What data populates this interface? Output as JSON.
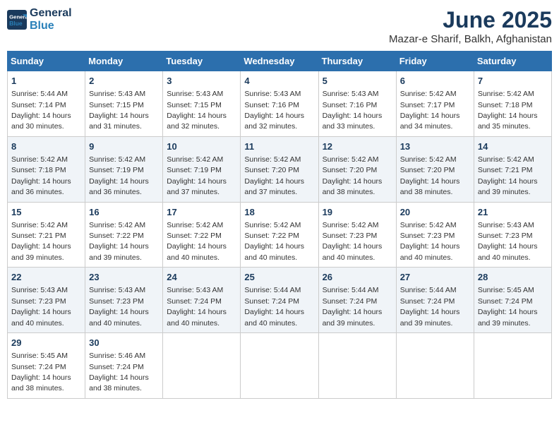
{
  "logo": {
    "line1": "General",
    "line2": "Blue"
  },
  "title": "June 2025",
  "location": "Mazar-e Sharif, Balkh, Afghanistan",
  "weekdays": [
    "Sunday",
    "Monday",
    "Tuesday",
    "Wednesday",
    "Thursday",
    "Friday",
    "Saturday"
  ],
  "rows": [
    [
      {
        "day": "1",
        "sunrise": "5:44 AM",
        "sunset": "7:14 PM",
        "daylight": "14 hours and 30 minutes."
      },
      {
        "day": "2",
        "sunrise": "5:43 AM",
        "sunset": "7:15 PM",
        "daylight": "14 hours and 31 minutes."
      },
      {
        "day": "3",
        "sunrise": "5:43 AM",
        "sunset": "7:15 PM",
        "daylight": "14 hours and 32 minutes."
      },
      {
        "day": "4",
        "sunrise": "5:43 AM",
        "sunset": "7:16 PM",
        "daylight": "14 hours and 32 minutes."
      },
      {
        "day": "5",
        "sunrise": "5:43 AM",
        "sunset": "7:16 PM",
        "daylight": "14 hours and 33 minutes."
      },
      {
        "day": "6",
        "sunrise": "5:42 AM",
        "sunset": "7:17 PM",
        "daylight": "14 hours and 34 minutes."
      },
      {
        "day": "7",
        "sunrise": "5:42 AM",
        "sunset": "7:18 PM",
        "daylight": "14 hours and 35 minutes."
      }
    ],
    [
      {
        "day": "8",
        "sunrise": "5:42 AM",
        "sunset": "7:18 PM",
        "daylight": "14 hours and 36 minutes."
      },
      {
        "day": "9",
        "sunrise": "5:42 AM",
        "sunset": "7:19 PM",
        "daylight": "14 hours and 36 minutes."
      },
      {
        "day": "10",
        "sunrise": "5:42 AM",
        "sunset": "7:19 PM",
        "daylight": "14 hours and 37 minutes."
      },
      {
        "day": "11",
        "sunrise": "5:42 AM",
        "sunset": "7:20 PM",
        "daylight": "14 hours and 37 minutes."
      },
      {
        "day": "12",
        "sunrise": "5:42 AM",
        "sunset": "7:20 PM",
        "daylight": "14 hours and 38 minutes."
      },
      {
        "day": "13",
        "sunrise": "5:42 AM",
        "sunset": "7:20 PM",
        "daylight": "14 hours and 38 minutes."
      },
      {
        "day": "14",
        "sunrise": "5:42 AM",
        "sunset": "7:21 PM",
        "daylight": "14 hours and 39 minutes."
      }
    ],
    [
      {
        "day": "15",
        "sunrise": "5:42 AM",
        "sunset": "7:21 PM",
        "daylight": "14 hours and 39 minutes."
      },
      {
        "day": "16",
        "sunrise": "5:42 AM",
        "sunset": "7:22 PM",
        "daylight": "14 hours and 39 minutes."
      },
      {
        "day": "17",
        "sunrise": "5:42 AM",
        "sunset": "7:22 PM",
        "daylight": "14 hours and 40 minutes."
      },
      {
        "day": "18",
        "sunrise": "5:42 AM",
        "sunset": "7:22 PM",
        "daylight": "14 hours and 40 minutes."
      },
      {
        "day": "19",
        "sunrise": "5:42 AM",
        "sunset": "7:23 PM",
        "daylight": "14 hours and 40 minutes."
      },
      {
        "day": "20",
        "sunrise": "5:42 AM",
        "sunset": "7:23 PM",
        "daylight": "14 hours and 40 minutes."
      },
      {
        "day": "21",
        "sunrise": "5:43 AM",
        "sunset": "7:23 PM",
        "daylight": "14 hours and 40 minutes."
      }
    ],
    [
      {
        "day": "22",
        "sunrise": "5:43 AM",
        "sunset": "7:23 PM",
        "daylight": "14 hours and 40 minutes."
      },
      {
        "day": "23",
        "sunrise": "5:43 AM",
        "sunset": "7:23 PM",
        "daylight": "14 hours and 40 minutes."
      },
      {
        "day": "24",
        "sunrise": "5:43 AM",
        "sunset": "7:24 PM",
        "daylight": "14 hours and 40 minutes."
      },
      {
        "day": "25",
        "sunrise": "5:44 AM",
        "sunset": "7:24 PM",
        "daylight": "14 hours and 40 minutes."
      },
      {
        "day": "26",
        "sunrise": "5:44 AM",
        "sunset": "7:24 PM",
        "daylight": "14 hours and 39 minutes."
      },
      {
        "day": "27",
        "sunrise": "5:44 AM",
        "sunset": "7:24 PM",
        "daylight": "14 hours and 39 minutes."
      },
      {
        "day": "28",
        "sunrise": "5:45 AM",
        "sunset": "7:24 PM",
        "daylight": "14 hours and 39 minutes."
      }
    ],
    [
      {
        "day": "29",
        "sunrise": "5:45 AM",
        "sunset": "7:24 PM",
        "daylight": "14 hours and 38 minutes."
      },
      {
        "day": "30",
        "sunrise": "5:46 AM",
        "sunset": "7:24 PM",
        "daylight": "14 hours and 38 minutes."
      },
      null,
      null,
      null,
      null,
      null
    ]
  ],
  "labels": {
    "sunrise": "Sunrise:",
    "sunset": "Sunset:",
    "daylight": "Daylight:"
  }
}
